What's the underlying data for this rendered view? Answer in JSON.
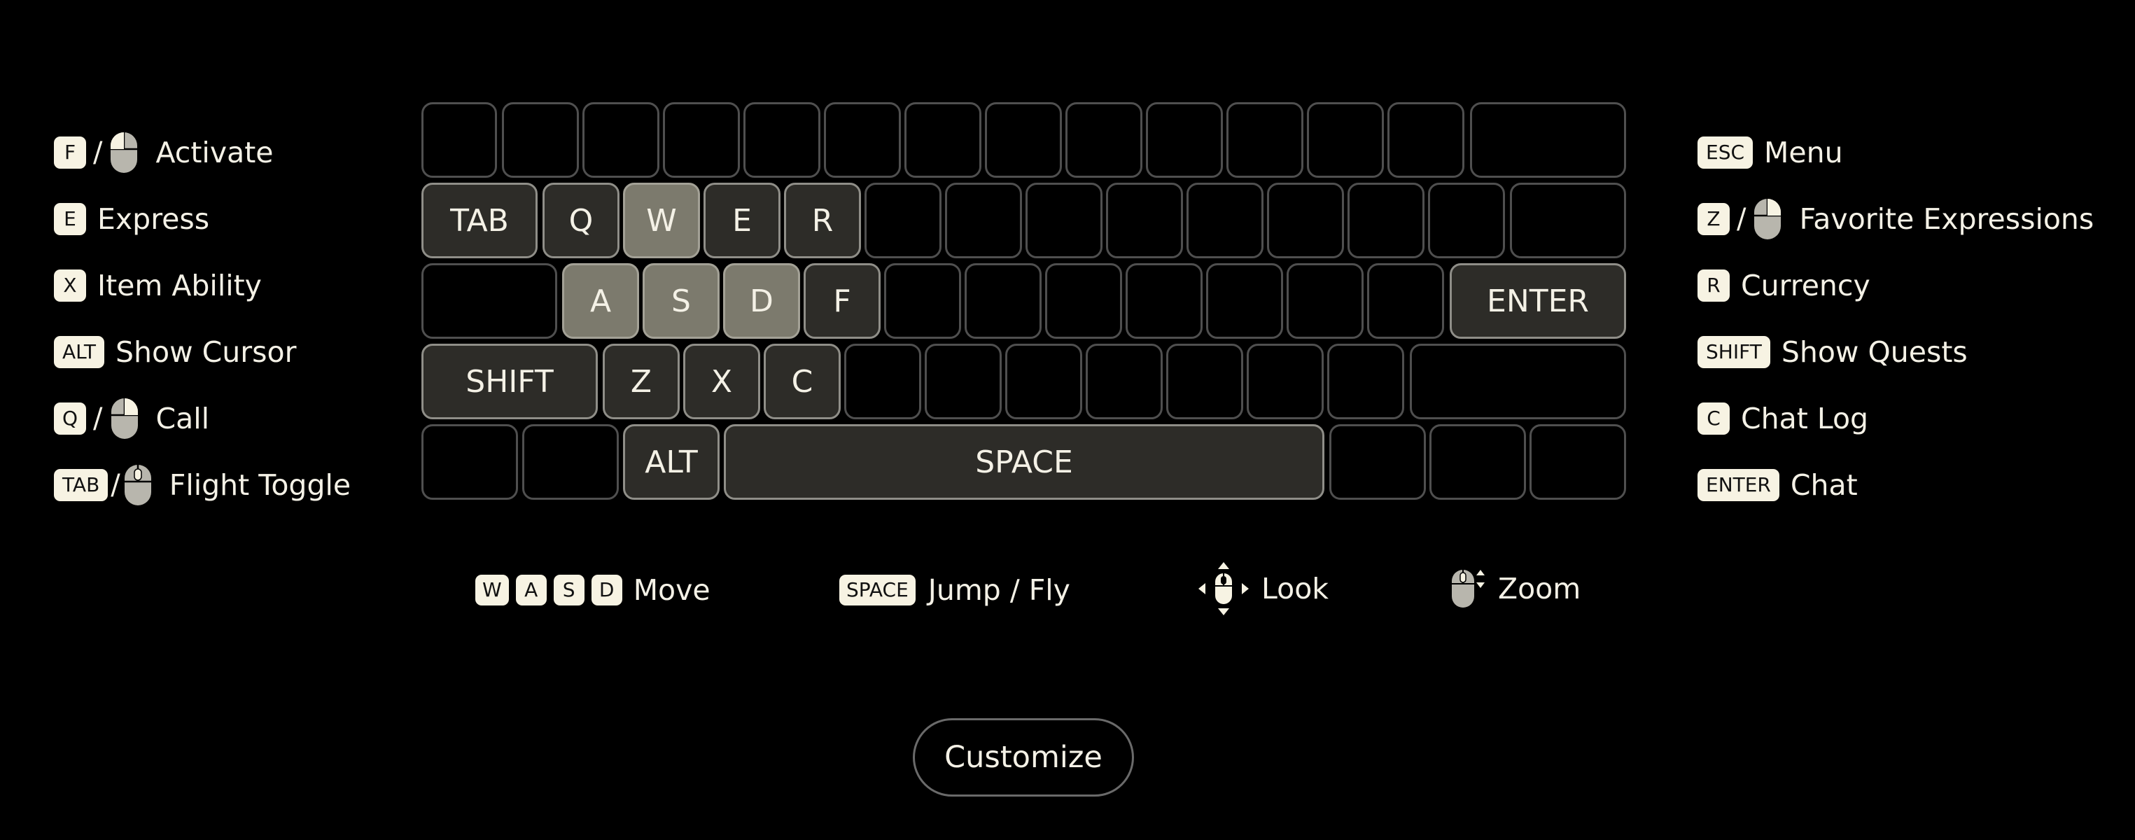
{
  "left_bindings": [
    {
      "key": "F",
      "mouse": true,
      "action": "Activate"
    },
    {
      "key": "E",
      "mouse": false,
      "action": "Express"
    },
    {
      "key": "X",
      "mouse": false,
      "action": "Item Ability"
    },
    {
      "key": "ALT",
      "mouse": false,
      "action": "Show Cursor"
    },
    {
      "key": "Q",
      "mouse": true,
      "action": "Call"
    },
    {
      "key": "TAB",
      "mouse": true,
      "action": "Flight Toggle"
    }
  ],
  "right_bindings": [
    {
      "key": "ESC",
      "mouse": false,
      "action": "Menu"
    },
    {
      "key": "Z",
      "mouse": true,
      "action": "Favorite Expressions"
    },
    {
      "key": "R",
      "mouse": false,
      "action": "Currency"
    },
    {
      "key": "SHIFT",
      "mouse": false,
      "action": "Show Quests"
    },
    {
      "key": "C",
      "mouse": false,
      "action": "Chat Log"
    },
    {
      "key": "ENTER",
      "mouse": false,
      "action": "Chat"
    }
  ],
  "separator": "/",
  "keyboard": {
    "row2": {
      "tab": "TAB",
      "q": "Q",
      "w": "W",
      "e": "E",
      "r": "R"
    },
    "row3": {
      "a": "A",
      "s": "S",
      "d": "D",
      "f": "F",
      "enter": "ENTER"
    },
    "row4": {
      "shift": "SHIFT",
      "z": "Z",
      "x": "X",
      "c": "C"
    },
    "row5": {
      "alt": "ALT",
      "space": "SPACE"
    }
  },
  "bottom": {
    "move": {
      "keys": [
        "W",
        "A",
        "S",
        "D"
      ],
      "label": "Move"
    },
    "jump": {
      "key": "SPACE",
      "label": "Jump / Fly"
    },
    "look": {
      "icon": "mouse-move-icon",
      "label": "Look"
    },
    "zoom": {
      "icon": "mouse-scroll-icon",
      "label": "Zoom"
    }
  },
  "customize_label": "Customize",
  "colors": {
    "background": "#000000",
    "badge": "#f7f3e3",
    "mapped_key": "#2d2c28",
    "wasd_key": "#7c7a6d",
    "text": "#f4f1e6"
  }
}
